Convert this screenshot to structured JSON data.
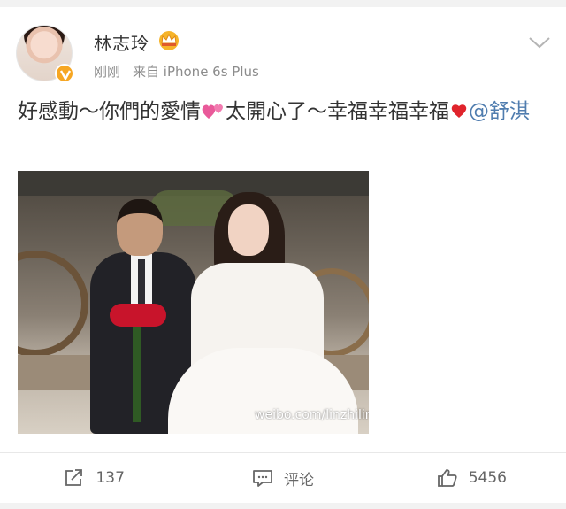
{
  "post": {
    "author": {
      "name": "林志玲",
      "avatar_icon": "avatar-photo",
      "verified_icon": "verified-v-icon",
      "vip_icon": "crown-icon"
    },
    "time": "刚刚",
    "source": "来自 iPhone 6s Plus",
    "text": {
      "part1": "好感動～你們的愛情",
      "part2": "太開心了～幸福幸福幸福",
      "mention": "@舒淇"
    },
    "image": {
      "watermark": "weibo.com/linzhiling"
    }
  },
  "actions": {
    "repost": {
      "icon": "share-icon",
      "label": "137"
    },
    "comment": {
      "icon": "comment-icon",
      "label": "评论"
    },
    "like": {
      "icon": "thumbs-up-icon",
      "label": "5456"
    }
  },
  "colors": {
    "accent_link": "#507daf",
    "verified": "#f6a623",
    "heart": "#e0242c"
  }
}
